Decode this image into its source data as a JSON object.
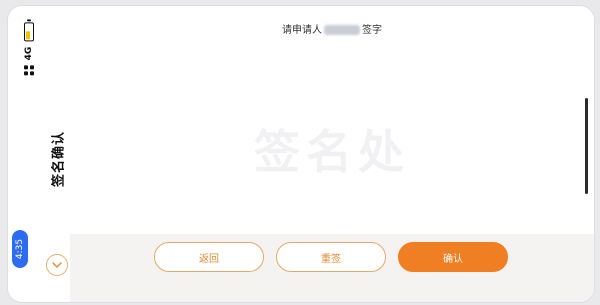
{
  "status": {
    "network": "4G",
    "time": "4:35"
  },
  "page": {
    "title": "签名确认"
  },
  "signature": {
    "prompt_prefix": "请申请人",
    "prompt_suffix": "签字",
    "watermark": "签名处"
  },
  "actions": {
    "back_label": "返回",
    "resign_label": "重签",
    "confirm_label": "确认"
  },
  "colors": {
    "accent": "#f07f23",
    "time_pill": "#2d6cf0"
  },
  "icons": {
    "expand": "chevron-down-icon",
    "battery": "battery-charging-icon",
    "signal": "signal-dots-icon"
  }
}
